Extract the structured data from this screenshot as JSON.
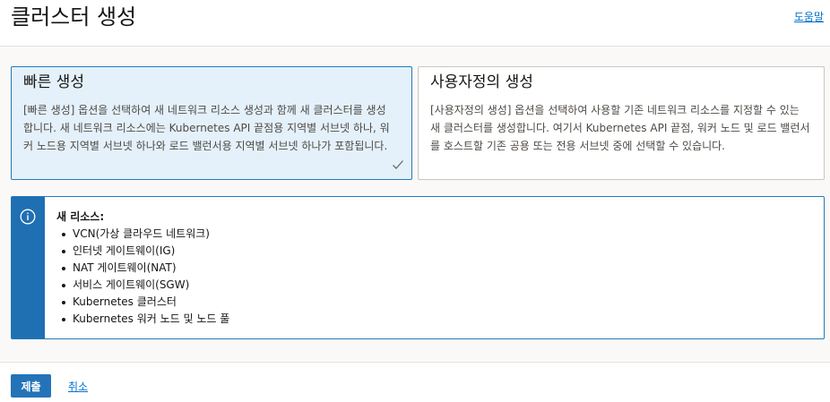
{
  "header": {
    "title": "클러스터 생성",
    "help_label": "도움말"
  },
  "options": [
    {
      "title": "빠른 생성",
      "description": "[빠른 생성] 옵션을 선택하여 새 네트워크 리소스 생성과 함께 새 클러스터를 생성합니다. 새 네트워크 리소스에는 Kubernetes API 끝점용 지역별 서브넷 하나, 워커 노드용 지역별 서브넷 하나와 로드 밸런서용 지역별 서브넷 하나가 포함됩니다.",
      "selected": true,
      "icon": "check-icon"
    },
    {
      "title": "사용자정의 생성",
      "description": "[사용자정의 생성] 옵션을 선택하여 사용할 기존 네트워크 리소스를 지정할 수 있는 새 클러스터를 생성합니다. 여기서 Kubernetes API 끝점, 워커 노드 및 로드 밸런서를 호스트할 기존 공용 또는 전용 서브넷 중에 선택할 수 있습니다.",
      "selected": false
    }
  ],
  "info": {
    "icon": "info-icon",
    "heading": "새 리소스:",
    "items": [
      "VCN(가상 클라우드 네트워크)",
      "인터넷 게이트웨이(IG)",
      "NAT 게이트웨이(NAT)",
      "서비스 게이트웨이(SGW)",
      "Kubernetes 클러스터",
      "Kubernetes 워커 노드 및 노드 풀"
    ]
  },
  "footer": {
    "submit_label": "제출",
    "cancel_label": "취소"
  },
  "colors": {
    "accent": "#2473b9",
    "selected_card_bg": "#e4f1fb",
    "link": "#0572ce"
  }
}
